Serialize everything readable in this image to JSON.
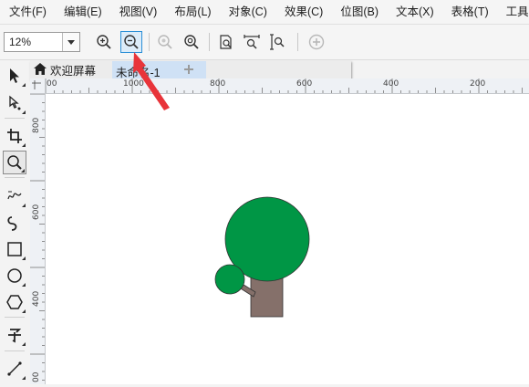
{
  "menubar": {
    "items": [
      {
        "label": "文件(F)"
      },
      {
        "label": "编辑(E)"
      },
      {
        "label": "视图(V)"
      },
      {
        "label": "布局(L)"
      },
      {
        "label": "对象(C)"
      },
      {
        "label": "效果(C)"
      },
      {
        "label": "位图(B)"
      },
      {
        "label": "文本(X)"
      },
      {
        "label": "表格(T)"
      },
      {
        "label": "工具(O)"
      }
    ]
  },
  "toolbar": {
    "zoom_value": "12%",
    "buttons": [
      {
        "icon": "zoom-in-icon"
      },
      {
        "icon": "zoom-out-icon",
        "active": true
      },
      {
        "icon": "zoom-selected-icon",
        "disabled": true
      },
      {
        "icon": "zoom-fit-all-icon"
      },
      {
        "icon": "zoom-page-icon"
      },
      {
        "icon": "zoom-page-width-icon"
      },
      {
        "icon": "zoom-page-height-icon"
      },
      {
        "icon": "add-icon",
        "disabled": true
      }
    ]
  },
  "tabs": {
    "welcome_label": "欢迎屏幕",
    "document_label": "未命名-1",
    "add_label": "+"
  },
  "ruler_top": {
    "labels": [
      "1000",
      "800",
      "600",
      "400",
      "200"
    ],
    "origin_label": "00"
  },
  "ruler_left": {
    "labels": [
      "800",
      "600",
      "400",
      "00"
    ]
  },
  "annotation": {
    "arrow_color": "#e8343a"
  },
  "drawing": {
    "crown_color": "#009645",
    "trunk_color": "#85706a",
    "outline_color": "#333333"
  }
}
